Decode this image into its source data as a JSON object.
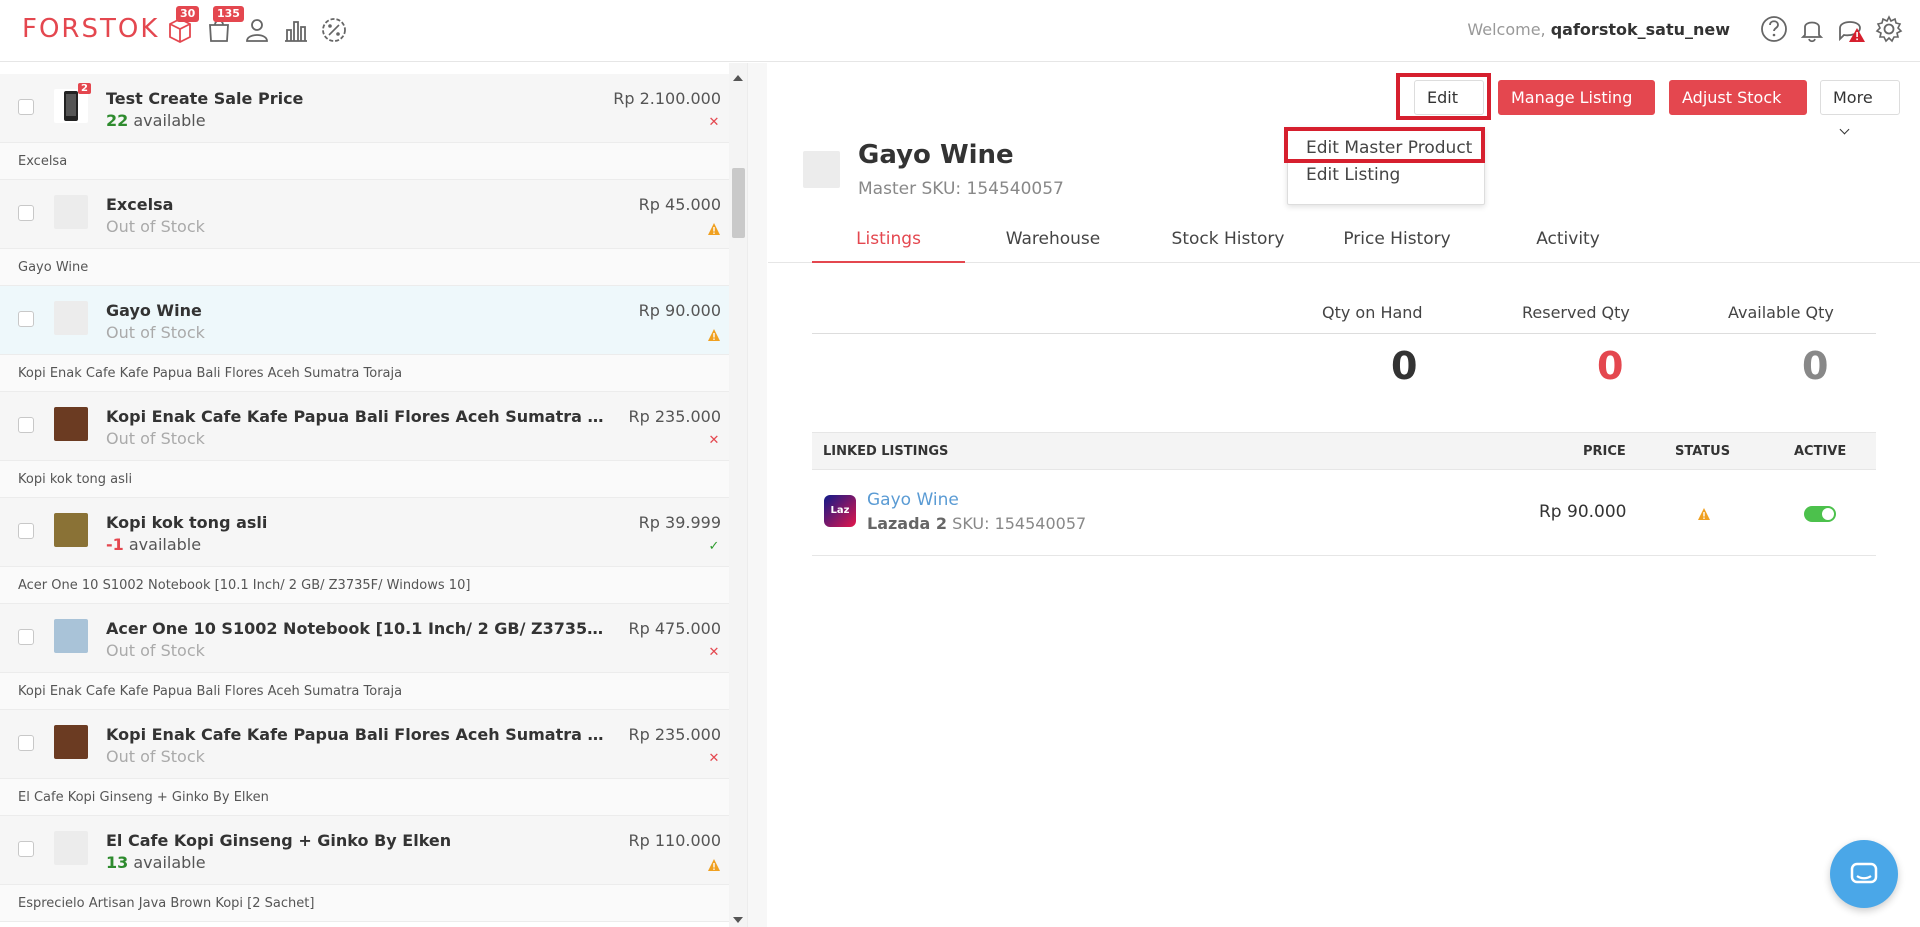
{
  "app": {
    "logo": "FORSTOK",
    "nav_badges": {
      "orders": "30",
      "bags": "135"
    },
    "welcome_prefix": "Welcome,",
    "username": "qaforstok_satu_new"
  },
  "colors": {
    "brand": "#e4474f",
    "selected_row": "#eef8fb",
    "link": "#5a9bd4",
    "toggle_on": "#4cc14c"
  },
  "list": {
    "items": [
      {
        "group": "",
        "name": "Test Create Sale Price",
        "stock_num": "22",
        "stock_text": "available",
        "stock_type": "green",
        "price": "Rp 2.100.000",
        "status": "x"
      },
      {
        "group": "Excelsa",
        "name": "Excelsa",
        "stock_num": "",
        "stock_text": "Out of Stock",
        "stock_type": "out",
        "price": "Rp 45.000",
        "status": "warn"
      },
      {
        "group": "Gayo Wine",
        "name": "Gayo Wine",
        "stock_num": "",
        "stock_text": "Out of Stock",
        "stock_type": "out",
        "price": "Rp 90.000",
        "status": "warn"
      },
      {
        "group": "Kopi Enak Cafe Kafe Papua Bali Flores Aceh Sumatra Toraja",
        "name": "Kopi Enak Cafe Kafe Papua Bali Flores Aceh Sumatra Toraja",
        "stock_num": "",
        "stock_text": "Out of Stock",
        "stock_type": "out",
        "price": "Rp 235.000",
        "status": "x"
      },
      {
        "group": "Kopi kok tong asli",
        "name": "Kopi kok tong asli",
        "stock_num": "-1",
        "stock_text": "available",
        "stock_type": "red",
        "price": "Rp 39.999",
        "status": "check"
      },
      {
        "group": "Acer One 10 S1002 Notebook [10.1 Inch/ 2 GB/ Z3735F/ Windows 10]",
        "name": "Acer One 10 S1002 Notebook [10.1 Inch/ 2 GB/ Z3735F/ Win...",
        "stock_num": "",
        "stock_text": "Out of Stock",
        "stock_type": "out",
        "price": "Rp 475.000",
        "status": "x"
      },
      {
        "group": "Kopi Enak Cafe Kafe Papua Bali Flores Aceh Sumatra Toraja",
        "name": "Kopi Enak Cafe Kafe Papua Bali Flores Aceh Sumatra Toraja",
        "stock_num": "",
        "stock_text": "Out of Stock",
        "stock_type": "out",
        "price": "Rp 235.000",
        "status": "x"
      },
      {
        "group": "El Cafe Kopi Ginseng + Ginko By Elken",
        "name": "El Cafe Kopi Ginseng + Ginko By Elken",
        "stock_num": "13",
        "stock_text": "available",
        "stock_type": "green",
        "price": "Rp 110.000",
        "status": "warn"
      }
    ],
    "trailing_group": "Esprecielo Artisan Java Brown Kopi [2 Sachet]",
    "first_item_badge": "2"
  },
  "toolbar": {
    "edit_label": "Edit",
    "manage_listing_label": "Manage Listing",
    "adjust_stock_label": "Adjust Stock",
    "more_label": "More"
  },
  "edit_menu": {
    "items": [
      "Edit Master Product",
      "Edit Listing"
    ]
  },
  "product": {
    "title": "Gayo Wine",
    "master_sku": "Master SKU: 154540057"
  },
  "tabs": [
    "Listings",
    "Warehouse",
    "Stock History",
    "Price History",
    "Activity"
  ],
  "quantity": {
    "on_hand_label": "Qty on Hand",
    "reserved_label": "Reserved Qty",
    "available_label": "Available Qty",
    "on_hand": "0",
    "reserved": "0",
    "available": "0"
  },
  "linked_listings": {
    "headers": {
      "listings": "LINKED LISTINGS",
      "price": "PRICE",
      "status": "STATUS",
      "active": "ACTIVE"
    },
    "rows": [
      {
        "logo_text": "Laz",
        "name": "Gayo Wine",
        "channel": "Lazada 2",
        "sku": "SKU: 154540057",
        "price": "Rp  90.000",
        "status": "warn",
        "active": true
      }
    ]
  }
}
